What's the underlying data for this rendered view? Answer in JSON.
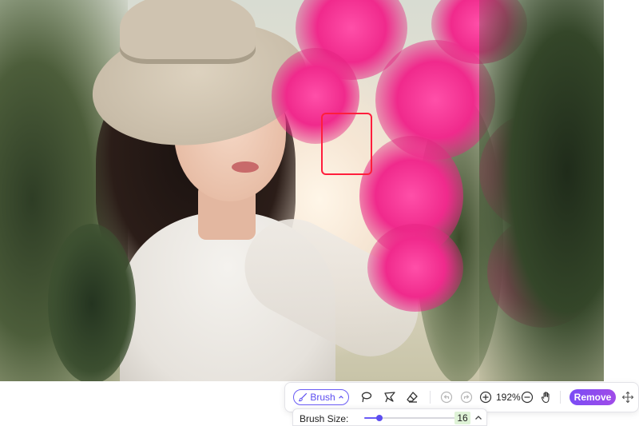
{
  "toolbar": {
    "brush_label": "Brush",
    "zoom_level": "192%",
    "remove_label": "Remove",
    "icons": {
      "brush": "paintbrush-icon",
      "brush_dropdown": "chevron-down-icon",
      "lasso": "lasso-icon",
      "polygon": "polygon-lasso-icon",
      "eraser": "eraser-icon",
      "undo": "undo-icon",
      "redo": "redo-icon",
      "zoom_in": "zoom-in-icon",
      "zoom_out": "zoom-out-icon",
      "pan": "hand-icon",
      "move": "move-icon"
    }
  },
  "brush_panel": {
    "label": "Brush Size:",
    "value": "16",
    "slider_fraction": 0.16
  },
  "colors": {
    "accent": "#5b4df0",
    "remove_gradient_start": "#7b4cf5",
    "remove_gradient_end": "#a04be8",
    "selection_box": "#ff1e3c",
    "value_bg": "#dff3d7"
  }
}
